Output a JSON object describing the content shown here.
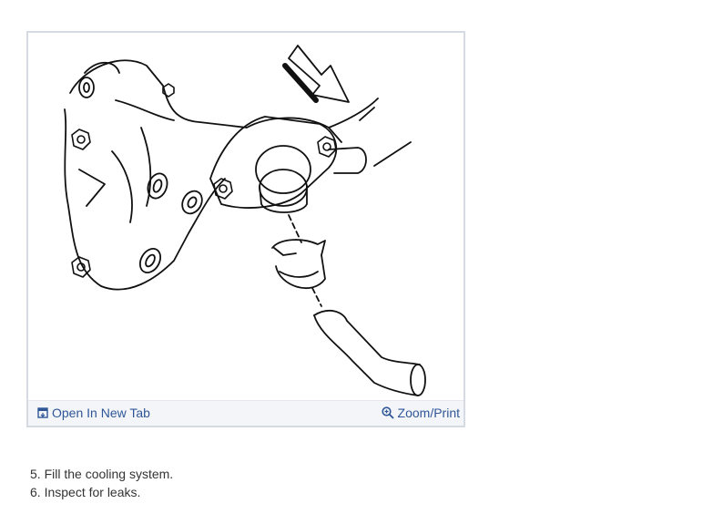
{
  "figure": {
    "open_label": "Open In New Tab",
    "zoom_label": "Zoom/Print"
  },
  "steps": [
    "5. Fill the cooling system.",
    "6. Inspect for leaks."
  ],
  "colors": {
    "link": "#2f5797",
    "frame_border": "#d6dbe3",
    "toolbar_bg": "#f3f5f8",
    "text": "#333333"
  },
  "icons": [
    "open-new-tab-icon",
    "zoom-icon",
    "direction-arrow"
  ]
}
